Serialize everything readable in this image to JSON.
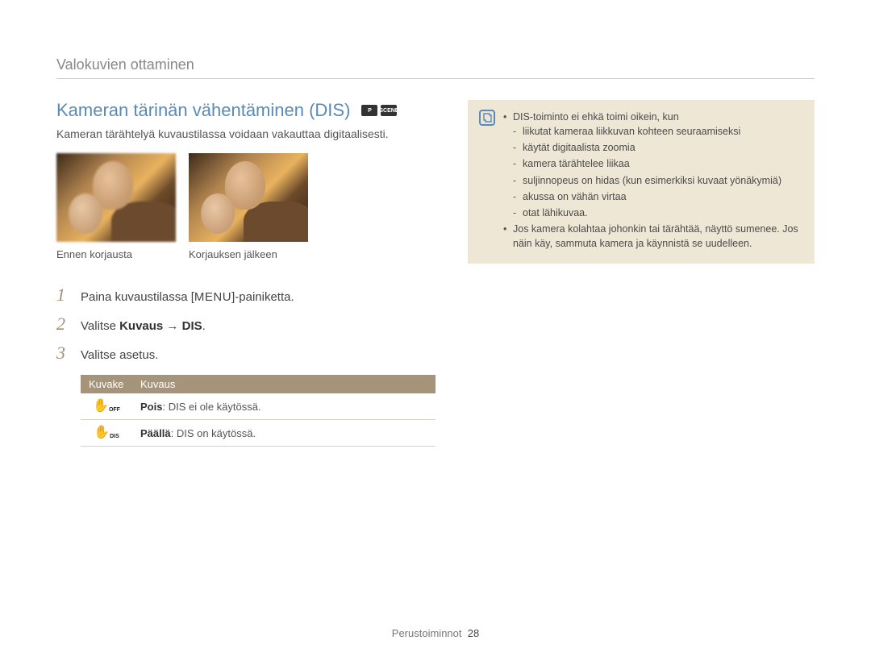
{
  "breadcrumb": "Valokuvien ottaminen",
  "title": "Kameran tärinän vähentäminen (DIS)",
  "mode_icons": [
    "P",
    "SCENE"
  ],
  "subtitle": "Kameran tärähtelyä kuvaustilassa voidaan vakauttaa digitaalisesti.",
  "photos": {
    "before_caption": "Ennen korjausta",
    "after_caption": "Korjauksen jälkeen"
  },
  "steps": [
    {
      "num": "1",
      "pre": "Paina kuvaustilassa [",
      "menu": "MENU",
      "post": "]-painiketta."
    },
    {
      "num": "2",
      "pre": "Valitse ",
      "bold1": "Kuvaus",
      "arrow": " → ",
      "bold2": "DIS",
      "post": "."
    },
    {
      "num": "3",
      "text": "Valitse asetus."
    }
  ],
  "table": {
    "header_icon": "Kuvake",
    "header_desc": "Kuvaus",
    "rows": [
      {
        "icon_sub": "OFF",
        "label": "Pois",
        "desc": ": DIS ei ole käytössä."
      },
      {
        "icon_sub": "DIS",
        "label": "Päällä",
        "desc": ": DIS on käytössä."
      }
    ]
  },
  "note": {
    "intro": "DIS-toiminto ei ehkä toimi oikein, kun",
    "sub": [
      "liikutat kameraa liikkuvan kohteen seuraamiseksi",
      "käytät digitaalista zoomia",
      "kamera tärähtelee liikaa",
      "suljinnopeus on hidas (kun esimerkiksi kuvaat yönäkymiä)",
      "akussa on vähän virtaa",
      "otat lähikuvaa."
    ],
    "second": "Jos kamera kolahtaa johonkin tai tärähtää, näyttö sumenee. Jos näin käy, sammuta kamera ja käynnistä se uudelleen."
  },
  "footer": {
    "section": "Perustoiminnot",
    "page": "28"
  }
}
